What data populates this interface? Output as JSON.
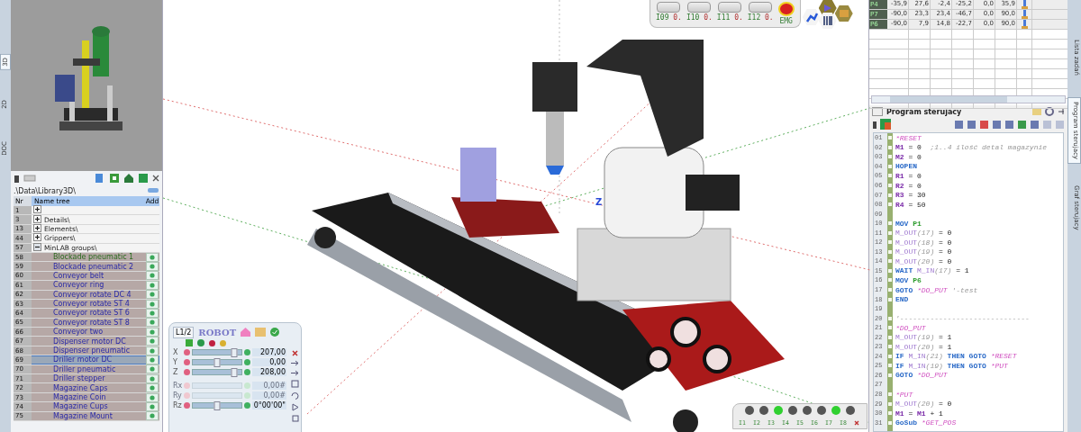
{
  "left_tabs": [
    {
      "label": "3D",
      "selected": true
    },
    {
      "label": "2D",
      "selected": false
    },
    {
      "label": "DOC",
      "selected": false
    }
  ],
  "library": {
    "path": ".\\Data\\Library3D\\",
    "columns": [
      "Nr",
      "Name tree",
      "Add"
    ],
    "tree": [
      {
        "nr": "1",
        "expanded": false
      },
      {
        "nr": "3",
        "name": "Details\\",
        "expanded": false
      },
      {
        "nr": "13",
        "name": "Elements\\",
        "expanded": false
      },
      {
        "nr": "44",
        "name": "Grippers\\",
        "expanded": false
      },
      {
        "nr": "57",
        "name": "MinLAB groups\\",
        "expanded": true,
        "children": [
          {
            "nr": "58",
            "name": "Blockade pneumatic 1",
            "active": true,
            "selected": false
          },
          {
            "nr": "59",
            "name": "Blockade pneumatic 2",
            "active": false,
            "selected": false
          },
          {
            "nr": "60",
            "name": "Conveyor belt",
            "active": false,
            "selected": false
          },
          {
            "nr": "61",
            "name": "Conveyor ring",
            "active": false,
            "selected": false
          },
          {
            "nr": "62",
            "name": "Conveyor rotate DC 4",
            "active": false,
            "selected": false
          },
          {
            "nr": "63",
            "name": "Conveyor rotate ST 4",
            "active": false,
            "selected": false
          },
          {
            "nr": "64",
            "name": "Conveyor rotate ST 6",
            "active": false,
            "selected": false
          },
          {
            "nr": "65",
            "name": "Conveyor rotate ST 8",
            "active": false,
            "selected": false
          },
          {
            "nr": "66",
            "name": "Conveyor two",
            "active": false,
            "selected": false
          },
          {
            "nr": "67",
            "name": "Dispenser motor DC",
            "active": false,
            "selected": false
          },
          {
            "nr": "68",
            "name": "Dispenser pneumatic",
            "active": false,
            "selected": false
          },
          {
            "nr": "69",
            "name": "Driller motor DC",
            "active": false,
            "selected": true
          },
          {
            "nr": "70",
            "name": "Driller pneumatic",
            "active": false,
            "selected": false
          },
          {
            "nr": "71",
            "name": "Driller stepper",
            "active": false,
            "selected": false
          },
          {
            "nr": "72",
            "name": "Magazine Caps",
            "active": false,
            "selected": false
          },
          {
            "nr": "73",
            "name": "Magazine Coin",
            "active": false,
            "selected": false
          },
          {
            "nr": "74",
            "name": "Magazine Cups",
            "active": false,
            "selected": false
          },
          {
            "nr": "75",
            "name": "Magazine Mount",
            "active": false,
            "selected": false
          }
        ]
      }
    ]
  },
  "scene": {
    "axis_label": "Z"
  },
  "robot": {
    "title": "ROBOT",
    "tab": "L1/2",
    "axes": [
      {
        "label": "X",
        "level": 0.85,
        "reading": "207,00",
        "disabled": false
      },
      {
        "label": "Y",
        "level": 0.5,
        "reading": "0,00",
        "disabled": false
      },
      {
        "label": "Z",
        "level": 0.85,
        "reading": "208,00",
        "disabled": false
      },
      {
        "label": "Rx",
        "reading": "0,00#",
        "disabled": true
      },
      {
        "label": "Ry",
        "reading": "0,00#",
        "disabled": true
      },
      {
        "label": "Rz",
        "level": 0.5,
        "reading": "0°00'00\"",
        "disabled": false
      }
    ]
  },
  "io_top": {
    "inputs": [
      {
        "label": "I09",
        "value": "0."
      },
      {
        "label": "I10",
        "value": "0."
      },
      {
        "label": "I11",
        "value": "0."
      },
      {
        "label": "I12",
        "value": "0."
      }
    ],
    "emergency": "EMG"
  },
  "io_bottom": [
    {
      "label": "I1",
      "on": false
    },
    {
      "label": "I2",
      "on": false
    },
    {
      "label": "I3",
      "on": true
    },
    {
      "label": "I4",
      "on": false
    },
    {
      "label": "I5",
      "on": false
    },
    {
      "label": "I6",
      "on": false
    },
    {
      "label": "I7",
      "on": true
    },
    {
      "label": "I8",
      "on": false
    }
  ],
  "points_table": {
    "rows": [
      {
        "name": "P4",
        "values": [
          "-35,9",
          "27,6",
          "-2,4",
          "-25,2",
          "0,0",
          "35,9"
        ]
      },
      {
        "name": "P7",
        "values": [
          "-90,0",
          "23,3",
          "23,4",
          "-46,7",
          "0,0",
          "90,0"
        ]
      },
      {
        "name": "P6",
        "values": [
          "-90,0",
          "7,9",
          "14,8",
          "-22,7",
          "0,0",
          "90,0"
        ]
      }
    ]
  },
  "program": {
    "title": "Program sterujacy",
    "lines": [
      {
        "number": "01",
        "tokens": [
          {
            "kind": "label",
            "text": "*RESET"
          }
        ]
      },
      {
        "number": "02",
        "tokens": [
          {
            "kind": "var",
            "text": "M1"
          },
          {
            "kind": "text",
            "text": " = 0  "
          },
          {
            "kind": "comment",
            "text": ";1..4 ilość detal magazynie"
          }
        ]
      },
      {
        "number": "03",
        "tokens": [
          {
            "kind": "var",
            "text": "M2"
          },
          {
            "kind": "text",
            "text": " = 0"
          }
        ]
      },
      {
        "number": "04",
        "tokens": [
          {
            "kind": "kw",
            "text": "HOPEN"
          }
        ]
      },
      {
        "number": "05",
        "tokens": [
          {
            "kind": "var",
            "text": "R1"
          },
          {
            "kind": "text",
            "text": " = 0"
          }
        ]
      },
      {
        "number": "06",
        "tokens": [
          {
            "kind": "var",
            "text": "R2"
          },
          {
            "kind": "text",
            "text": " = 0"
          }
        ]
      },
      {
        "number": "07",
        "tokens": [
          {
            "kind": "var",
            "text": "R3"
          },
          {
            "kind": "text",
            "text": " = 30"
          }
        ]
      },
      {
        "number": "08",
        "tokens": [
          {
            "kind": "var",
            "text": "R4"
          },
          {
            "kind": "text",
            "text": " = 50"
          }
        ]
      },
      {
        "number": "09"
      },
      {
        "number": "10",
        "tokens": [
          {
            "kind": "kw",
            "text": "MOV "
          },
          {
            "kind": "point",
            "text": "P1"
          }
        ]
      },
      {
        "number": "11",
        "tokens": [
          {
            "kind": "func",
            "text": "M_OUT"
          },
          {
            "kind": "arg",
            "text": "(17)"
          },
          {
            "kind": "text",
            "text": " = 0"
          }
        ]
      },
      {
        "number": "12",
        "tokens": [
          {
            "kind": "func",
            "text": "M_OUT"
          },
          {
            "kind": "arg",
            "text": "(18)"
          },
          {
            "kind": "text",
            "text": " = 0"
          }
        ]
      },
      {
        "number": "13",
        "tokens": [
          {
            "kind": "func",
            "text": "M_OUT"
          },
          {
            "kind": "arg",
            "text": "(19)"
          },
          {
            "kind": "text",
            "text": " = 0"
          }
        ]
      },
      {
        "number": "14",
        "tokens": [
          {
            "kind": "func",
            "text": "M_OUT"
          },
          {
            "kind": "arg",
            "text": "(20)"
          },
          {
            "kind": "text",
            "text": " = 0"
          }
        ]
      },
      {
        "number": "15",
        "tokens": [
          {
            "kind": "kw",
            "text": "WAIT "
          },
          {
            "kind": "func",
            "text": "M_IN"
          },
          {
            "kind": "arg",
            "text": "(17)"
          },
          {
            "kind": "text",
            "text": " = 1"
          }
        ]
      },
      {
        "number": "16",
        "tokens": [
          {
            "kind": "kw",
            "text": "MOV "
          },
          {
            "kind": "point",
            "text": "P6"
          }
        ]
      },
      {
        "number": "17",
        "tokens": [
          {
            "kind": "kw",
            "text": "GOTO "
          },
          {
            "kind": "label",
            "text": "*DO_PUT "
          },
          {
            "kind": "comment",
            "text": "'-test"
          }
        ]
      },
      {
        "number": "18",
        "tokens": [
          {
            "kind": "kw",
            "text": "END"
          }
        ]
      },
      {
        "number": "19"
      },
      {
        "number": "20",
        "tokens": [
          {
            "kind": "comment",
            "text": "'------------------------------"
          }
        ]
      },
      {
        "number": "21",
        "tokens": [
          {
            "kind": "label",
            "text": "*DO_PUT"
          }
        ]
      },
      {
        "number": "22",
        "tokens": [
          {
            "kind": "func",
            "text": "M_OUT"
          },
          {
            "kind": "arg",
            "text": "(19)"
          },
          {
            "kind": "text",
            "text": " = 1"
          }
        ]
      },
      {
        "number": "23",
        "tokens": [
          {
            "kind": "func",
            "text": "M_OUT"
          },
          {
            "kind": "arg",
            "text": "(20)"
          },
          {
            "kind": "text",
            "text": " = 1"
          }
        ]
      },
      {
        "number": "24",
        "tokens": [
          {
            "kind": "kw",
            "text": "IF "
          },
          {
            "kind": "func",
            "text": "M_IN"
          },
          {
            "kind": "arg",
            "text": "(21)"
          },
          {
            "kind": "kw",
            "text": " THEN GOTO "
          },
          {
            "kind": "label",
            "text": "*RESET"
          }
        ]
      },
      {
        "number": "25",
        "tokens": [
          {
            "kind": "kw",
            "text": "IF "
          },
          {
            "kind": "func",
            "text": "M_IN"
          },
          {
            "kind": "arg",
            "text": "(19)"
          },
          {
            "kind": "kw",
            "text": " THEN GOTO "
          },
          {
            "kind": "label",
            "text": "*PUT"
          }
        ]
      },
      {
        "number": "26",
        "tokens": [
          {
            "kind": "kw",
            "text": "GOTO "
          },
          {
            "kind": "label",
            "text": "*DO_PUT"
          }
        ]
      },
      {
        "number": "27"
      },
      {
        "number": "28",
        "tokens": [
          {
            "kind": "label",
            "text": "*PUT"
          }
        ]
      },
      {
        "number": "29",
        "tokens": [
          {
            "kind": "func",
            "text": "M_OUT"
          },
          {
            "kind": "arg",
            "text": "(20)"
          },
          {
            "kind": "text",
            "text": " = 0"
          }
        ]
      },
      {
        "number": "30",
        "tokens": [
          {
            "kind": "var",
            "text": "M1"
          },
          {
            "kind": "text",
            "text": " = "
          },
          {
            "kind": "var",
            "text": "M1"
          },
          {
            "kind": "text",
            "text": " + 1"
          }
        ]
      },
      {
        "number": "31",
        "tokens": [
          {
            "kind": "kw",
            "text": "GoSub "
          },
          {
            "kind": "label",
            "text": "*GET_POS"
          }
        ]
      }
    ]
  },
  "right_tabs": [
    {
      "label": "Lista zadań",
      "selected": false
    },
    {
      "label": "Program sterujacy",
      "selected": true
    },
    {
      "label": "Graf sterujacy",
      "selected": false
    }
  ]
}
